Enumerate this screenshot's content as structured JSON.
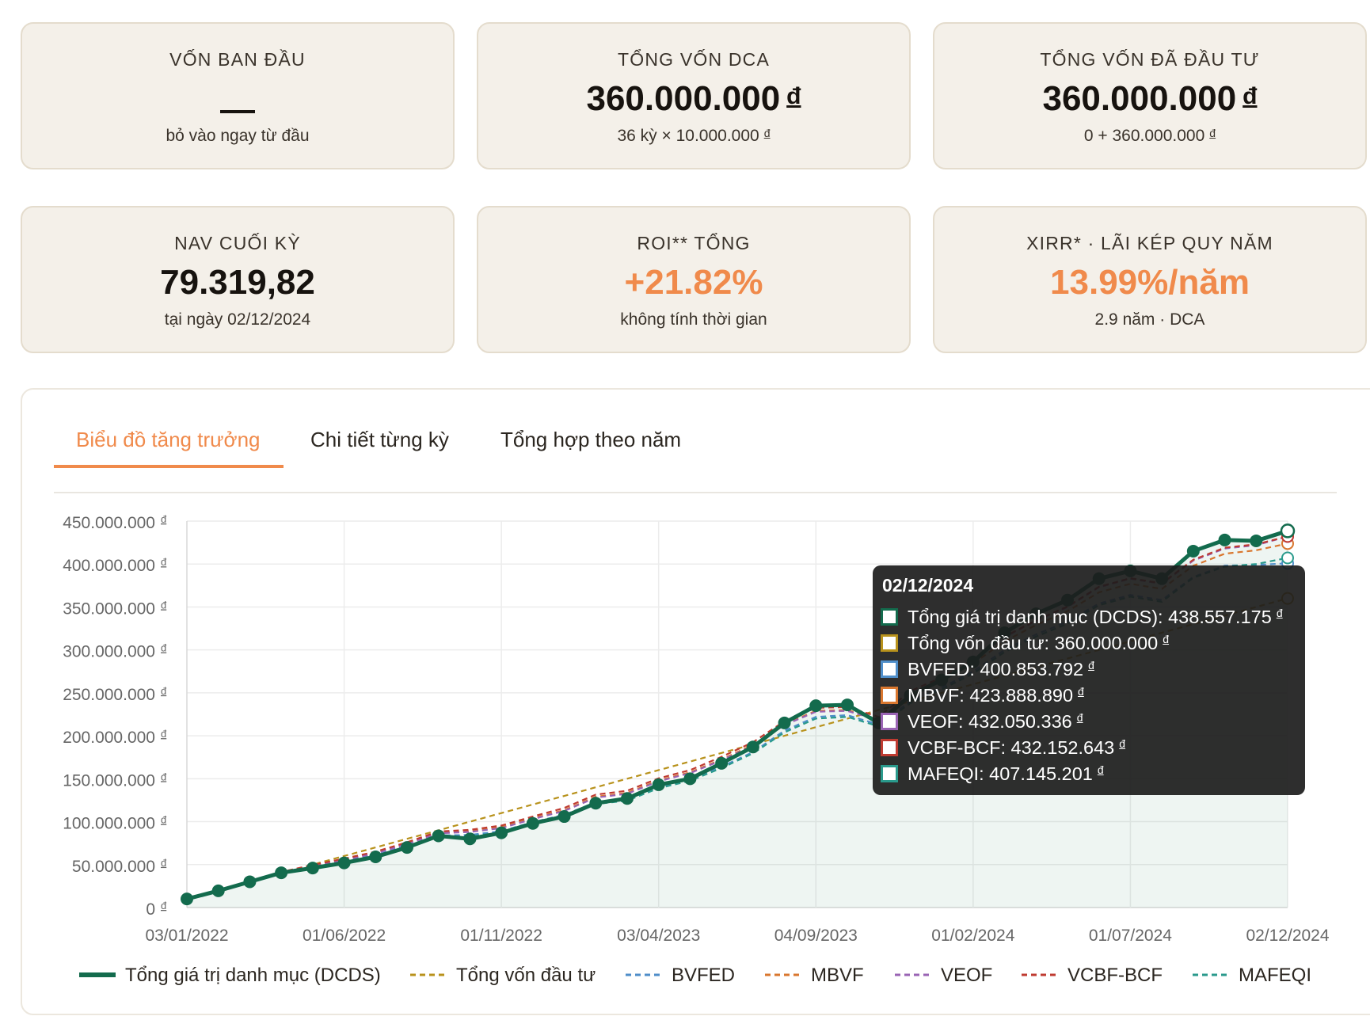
{
  "cards": {
    "von_ban_dau": {
      "label": "VỐN BAN ĐẦU",
      "sub": "bỏ vào ngay từ đầu"
    },
    "tong_von_dca": {
      "label": "TỔNG VỐN DCA",
      "value": "360.000.000",
      "currency": "đ",
      "sub": "36 kỳ × 10.000.000",
      "sub_currency": "đ"
    },
    "tong_von_da_dau_tu": {
      "label": "TỔNG VỐN ĐÃ ĐẦU TƯ",
      "value": "360.000.000",
      "currency": "đ",
      "sub": "0 + 360.000.000",
      "sub_currency": "đ"
    },
    "nav_cuoi_ky": {
      "label": "NAV CUỐI KỲ",
      "value": "79.319,82",
      "sub": "tại ngày 02/12/2024"
    },
    "roi_tong": {
      "label": "ROI** TỔNG",
      "value": "+21.82%",
      "sub": "không tính thời gian"
    },
    "xirr": {
      "label": "XIRR* · LÃI KÉP QUY NĂM",
      "value": "13.99%/năm",
      "sub": "2.9 năm · DCA"
    }
  },
  "tabs": [
    {
      "label": "Biểu đồ tăng trưởng",
      "active": true
    },
    {
      "label": "Chi tiết từng kỳ",
      "active": false
    },
    {
      "label": "Tổng hợp theo năm",
      "active": false
    }
  ],
  "colors": {
    "accent": "#f08a4b",
    "portfolio": "#136b4d",
    "invested": "#b8921c",
    "bvfed": "#4f8ec9",
    "mbvf": "#d9772f",
    "veof": "#9a64b4",
    "vcbf": "#bf3b31",
    "mafeqi": "#2a9a8c"
  },
  "chart_data": {
    "type": "line",
    "y_ticks": [
      "450.000.000",
      "400.000.000",
      "350.000.000",
      "300.000.000",
      "250.000.000",
      "200.000.000",
      "150.000.000",
      "100.000.000",
      "50.000.000",
      "0"
    ],
    "y_currency": "đ",
    "ylim": [
      0,
      450000000
    ],
    "x_ticks": [
      "03/01/2022",
      "01/06/2022",
      "01/11/2022",
      "03/04/2023",
      "04/09/2023",
      "01/02/2024",
      "01/07/2024",
      "02/12/2024"
    ],
    "period_count": 36,
    "series": [
      {
        "name": "Tổng giá trị danh mục (DCDS)",
        "key": "portfolio",
        "values": [
          10000000,
          19500000,
          30000000,
          40500000,
          46000000,
          52000000,
          59000000,
          70000000,
          83500000,
          80000000,
          87000000,
          98000000,
          106000000,
          121500000,
          127000000,
          143000000,
          150000000,
          168000000,
          187000000,
          215000000,
          235000000,
          236000000,
          215000000,
          247000000,
          265000000,
          286000000,
          320000000,
          342000000,
          358000000,
          383000000,
          392000000,
          383000000,
          415000000,
          428000000,
          427000000,
          438557175
        ]
      },
      {
        "name": "Tổng vốn đầu tư",
        "key": "invested",
        "values": [
          10000000,
          20000000,
          30000000,
          40000000,
          50000000,
          60000000,
          70000000,
          80000000,
          90000000,
          100000000,
          110000000,
          120000000,
          130000000,
          140000000,
          150000000,
          160000000,
          170000000,
          180000000,
          190000000,
          200000000,
          210000000,
          220000000,
          230000000,
          240000000,
          250000000,
          260000000,
          270000000,
          280000000,
          290000000,
          300000000,
          310000000,
          320000000,
          330000000,
          340000000,
          350000000,
          360000000
        ]
      },
      {
        "name": "BVFED",
        "key": "bvfed",
        "values": [
          10000000,
          19600000,
          30000000,
          40500000,
          47000000,
          54000000,
          61000000,
          72000000,
          84000000,
          84500000,
          89000000,
          99500000,
          108000000,
          122500000,
          126000000,
          140500000,
          149000000,
          164000000,
          181000000,
          206000000,
          222000000,
          224000000,
          213000000,
          240000000,
          256000000,
          275000000,
          300000000,
          318000000,
          333000000,
          354000000,
          364000000,
          358000000,
          385000000,
          398000000,
          399000000,
          400853792
        ]
      },
      {
        "name": "MBVF",
        "key": "mbvf",
        "values": [
          10000000,
          19800000,
          30500000,
          41500000,
          49000000,
          56500000,
          64000000,
          75000000,
          87000000,
          89000000,
          93500000,
          104000000,
          113500000,
          129000000,
          133500000,
          148000000,
          157500000,
          172500000,
          189500000,
          213500000,
          229000000,
          230000000,
          219000000,
          248000000,
          264500000,
          284000000,
          310000000,
          329000000,
          345000000,
          367000000,
          377000000,
          371000000,
          398000000,
          412000000,
          416000000,
          423888890
        ]
      },
      {
        "name": "VEOF",
        "key": "veof",
        "values": [
          10000000,
          19700000,
          30300000,
          41000000,
          48000000,
          55500000,
          63000000,
          74000000,
          86500000,
          88000000,
          92500000,
          103000000,
          112500000,
          128000000,
          132500000,
          147000000,
          156500000,
          171500000,
          188500000,
          212500000,
          228000000,
          229000000,
          218000000,
          249000000,
          266000000,
          287000000,
          315000000,
          334000000,
          350000000,
          373000000,
          383000000,
          377000000,
          404000000,
          418000000,
          422000000,
          432050336
        ]
      },
      {
        "name": "VCBF-BCF",
        "key": "vcbf",
        "values": [
          10000000,
          19900000,
          30600000,
          41500000,
          49500000,
          57000000,
          65000000,
          76000000,
          88500000,
          90500000,
          95500000,
          106000000,
          116000000,
          131500000,
          136000000,
          150500000,
          160000000,
          175500000,
          192500000,
          217000000,
          232500000,
          233500000,
          222000000,
          252000000,
          268000000,
          288500000,
          315500000,
          334500000,
          350500000,
          373500000,
          383500000,
          377500000,
          405000000,
          419000000,
          423000000,
          432152643
        ]
      },
      {
        "name": "MAFEQI",
        "key": "mafeqi",
        "values": [
          10000000,
          19500000,
          29800000,
          40000000,
          46500000,
          53500000,
          60500000,
          71000000,
          82500000,
          83000000,
          87500000,
          97500000,
          106000000,
          120500000,
          124500000,
          139000000,
          147500000,
          162500000,
          179500000,
          204000000,
          220000000,
          222000000,
          211000000,
          238000000,
          254000000,
          272500000,
          297500000,
          315500000,
          330500000,
          352000000,
          362000000,
          356000000,
          384000000,
          397000000,
          400000000,
          407145201
        ]
      }
    ]
  },
  "tooltip": {
    "title": "02/12/2024",
    "rows": [
      {
        "text": "Tổng giá trị danh mục (DCDS): 438.557.175",
        "key": "portfolio"
      },
      {
        "text": "Tổng vốn đầu tư: 360.000.000",
        "key": "invested"
      },
      {
        "text": "BVFED: 400.853.792",
        "key": "bvfed"
      },
      {
        "text": "MBVF: 423.888.890",
        "key": "mbvf"
      },
      {
        "text": "VEOF: 432.050.336",
        "key": "veof"
      },
      {
        "text": "VCBF-BCF: 432.152.643",
        "key": "vcbf"
      },
      {
        "text": "MAFEQI: 407.145.201",
        "key": "mafeqi"
      }
    ],
    "currency": "đ"
  }
}
